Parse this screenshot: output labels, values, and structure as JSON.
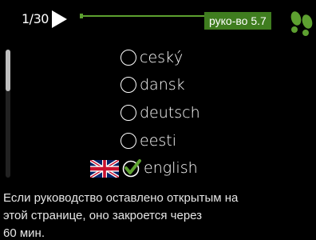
{
  "header": {
    "page_counter": "1/30",
    "manual_label": "руко-во 5.7",
    "accent_color": "#5da030",
    "badge_color": "#3f7d1f"
  },
  "languages": [
    {
      "label": "ceský",
      "selected": false
    },
    {
      "label": "dansk",
      "selected": false
    },
    {
      "label": "deutsch",
      "selected": false
    },
    {
      "label": "eesti",
      "selected": false
    },
    {
      "label": "english",
      "selected": true,
      "flag": "uk-flag-icon"
    }
  ],
  "scrollbar": {
    "position_fraction": 0.0
  },
  "info": {
    "line1": "Если руководство оставлено открытым на",
    "line2": "этой странице, оно закроется через",
    "line3": "60 мин."
  },
  "icons": [
    "play-icon",
    "footprints-icon",
    "uk-flag-icon",
    "check-icon"
  ]
}
